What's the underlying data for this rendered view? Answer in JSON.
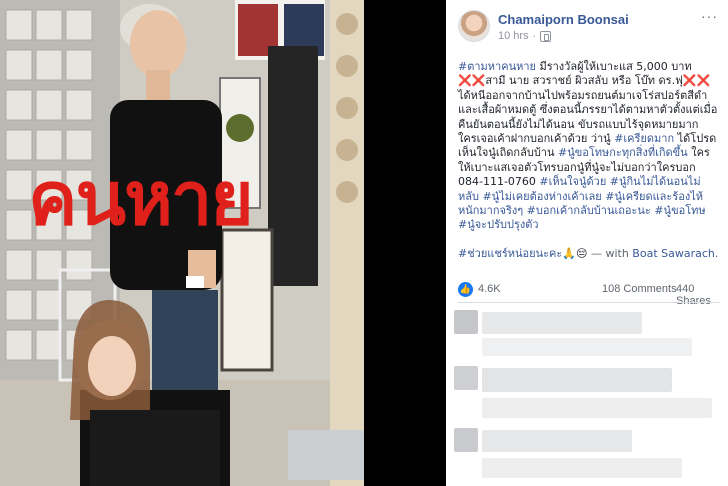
{
  "photo": {
    "overlay_text": "คนหาย"
  },
  "post": {
    "author": "Chamaiporn Boonsai",
    "time": "10 hrs",
    "more_label": "···",
    "paragraph1": [
      {
        "t": "#ตามหาคนหาย",
        "k": "hashtag"
      },
      {
        "t": " มีรางวัลผู้ให้เบาะแส 5,000 บาท ",
        "k": "text"
      },
      {
        "t": "❌❌",
        "k": "xmark"
      },
      {
        "t": "สามี นาย สวราชย์ ผิวสลับ หรือ โบ๊ท ดร.ฟุ",
        "k": "text"
      },
      {
        "t": "❌❌",
        "k": "xmark"
      },
      {
        "t": " ได้หนีออกจากบ้านไปพร้อมรถยนต์มาเจโร่สปอร์ตสีดำ และเสื้อผ้าหมดตู้ ซึ่งตอนนี้ภรรยาได้ตามหาตัวตั้งแต่เมื่อคืนยันตอนนี้ยังไม่ได้นอน ขับรถแบบไร้จุดหมายมาก ใครเจอเค้าฝากบอกเค้าด้วย ว่านู๋ ",
        "k": "text"
      },
      {
        "t": "#เครียดมาก",
        "k": "hashtag"
      },
      {
        "t": " ได้โปรดเห็นใจนู๋เถิดกลับบ้าน ",
        "k": "text"
      },
      {
        "t": "#นู๋ขอโทษกะทุกสิ่งที่เกิดขึ้น",
        "k": "hashtag"
      },
      {
        "t": " ใครให้เบาะแสเจอตัวโทรบอกนู๋ที่นู๋จะไม่บอกว่าใครบอก 084-111-0760 ",
        "k": "text"
      },
      {
        "t": "#เห็นใจนู๋ด้วย",
        "k": "hashtag"
      },
      {
        "t": " ",
        "k": "text"
      },
      {
        "t": "#นู๋กินไม่ได้นอนไม่หลับ",
        "k": "hashtag"
      },
      {
        "t": " ",
        "k": "text"
      },
      {
        "t": "#นู๋ไม่เคยต้องห่างเค้าเลย",
        "k": "hashtag"
      },
      {
        "t": " ",
        "k": "text"
      },
      {
        "t": "#นู๋เครียดและร้องไห้หนักมากจริงๆ",
        "k": "hashtag"
      },
      {
        "t": " ",
        "k": "text"
      },
      {
        "t": "#บอกเค้ากลับบ้านเถอะนะ",
        "k": "hashtag"
      },
      {
        "t": " ",
        "k": "text"
      },
      {
        "t": "#นู๋ขอโทษ",
        "k": "hashtag"
      },
      {
        "t": " ",
        "k": "text"
      },
      {
        "t": "#นู๋จะปรับปรุงตัว",
        "k": "hashtag"
      }
    ],
    "paragraph2": [
      {
        "t": "#ช่วยแชร์หน่อยนะคะ",
        "k": "hashtag"
      },
      {
        "t": "🙏😔",
        "k": "text"
      },
      {
        "t": " — with ",
        "k": "with"
      },
      {
        "t": "Boat Sawarach",
        "k": "withname"
      },
      {
        "t": ".",
        "k": "with"
      }
    ]
  },
  "stats": {
    "likes": "4.6K",
    "comments": "108 Comments",
    "shares": "440 Shares"
  }
}
